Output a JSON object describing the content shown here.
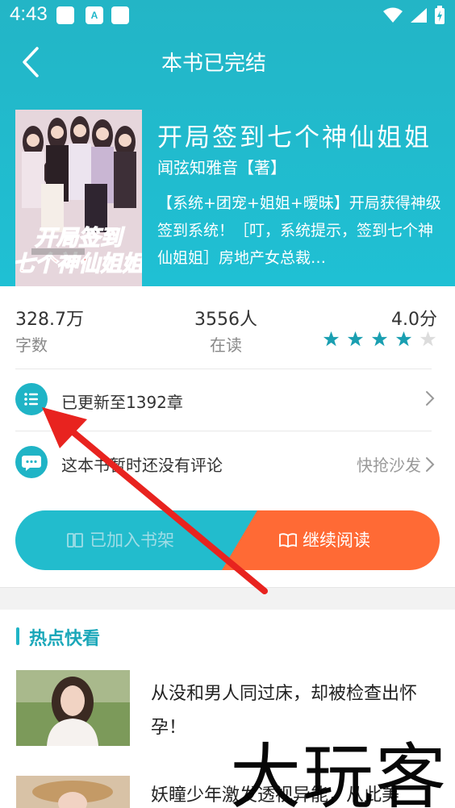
{
  "status_bar": {
    "time": "4:43"
  },
  "nav": {
    "title": "本书已完结"
  },
  "book": {
    "title": "开局签到七个神仙姐姐",
    "author": "闻弦知雅音【著】",
    "description": "【系统+团宠+姐姐+暧昧】开局获得神级签到系统！［叮，系统提示，签到七个神仙姐姐］房地产女总裁…",
    "cover_title": "开局签到七个神仙姐姐"
  },
  "stats": [
    {
      "value": "328.7万",
      "label": "字数"
    },
    {
      "value": "3556人",
      "label": "在读"
    },
    {
      "value": "4.0分",
      "rating": 4,
      "max": 5
    }
  ],
  "chapters": {
    "text": "已更新至1392章"
  },
  "comments": {
    "text": "这本书暂时还没有评论",
    "action": "快抢沙发"
  },
  "buttons": {
    "shelf": "已加入书架",
    "read": "继续阅读"
  },
  "hot": {
    "title": "热点快看",
    "items": [
      {
        "title": "从没和男人同过床，却被检查出怀孕！"
      },
      {
        "title": "妖瞳少年激发透视异能，从此美"
      }
    ]
  },
  "watermark": "大玩客",
  "colors": {
    "accent": "#1fb4c6",
    "orange": "#ff6a35",
    "arrow": "#e8231f"
  }
}
